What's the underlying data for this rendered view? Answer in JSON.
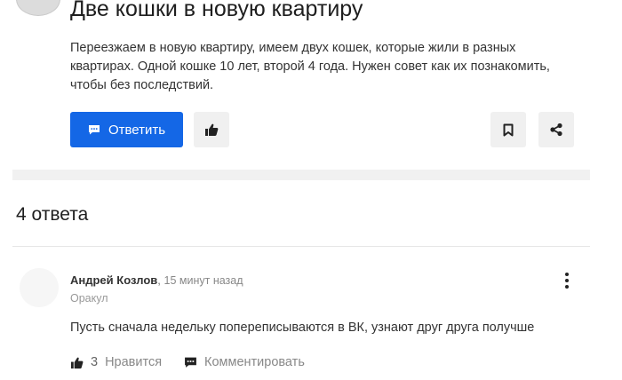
{
  "question": {
    "title": "Две кошки в новую квартиру",
    "text": "Переезжаем в новую квартиру, имеем двух кошек, которые жили в разных квартирах. Одной кошке 10 лет, второй 4 года. Нужен совет как их познакомить, чтобы без последствий.",
    "answer_button_label": "Ответить"
  },
  "answers_header": "4 ответа",
  "answer": {
    "author": "Андрей Козлов",
    "separator": ",",
    "time": "15 минут назад",
    "role": "Оракул",
    "text": "Пусть сначала недельку попереписываются в ВК, узнают друг друга получше",
    "like_count": "3",
    "like_label": "Нравится",
    "comment_label": "Комментировать"
  },
  "colors": {
    "accent": "#1467e6",
    "button_bg": "#f0f0f0",
    "muted_text": "#888888"
  }
}
